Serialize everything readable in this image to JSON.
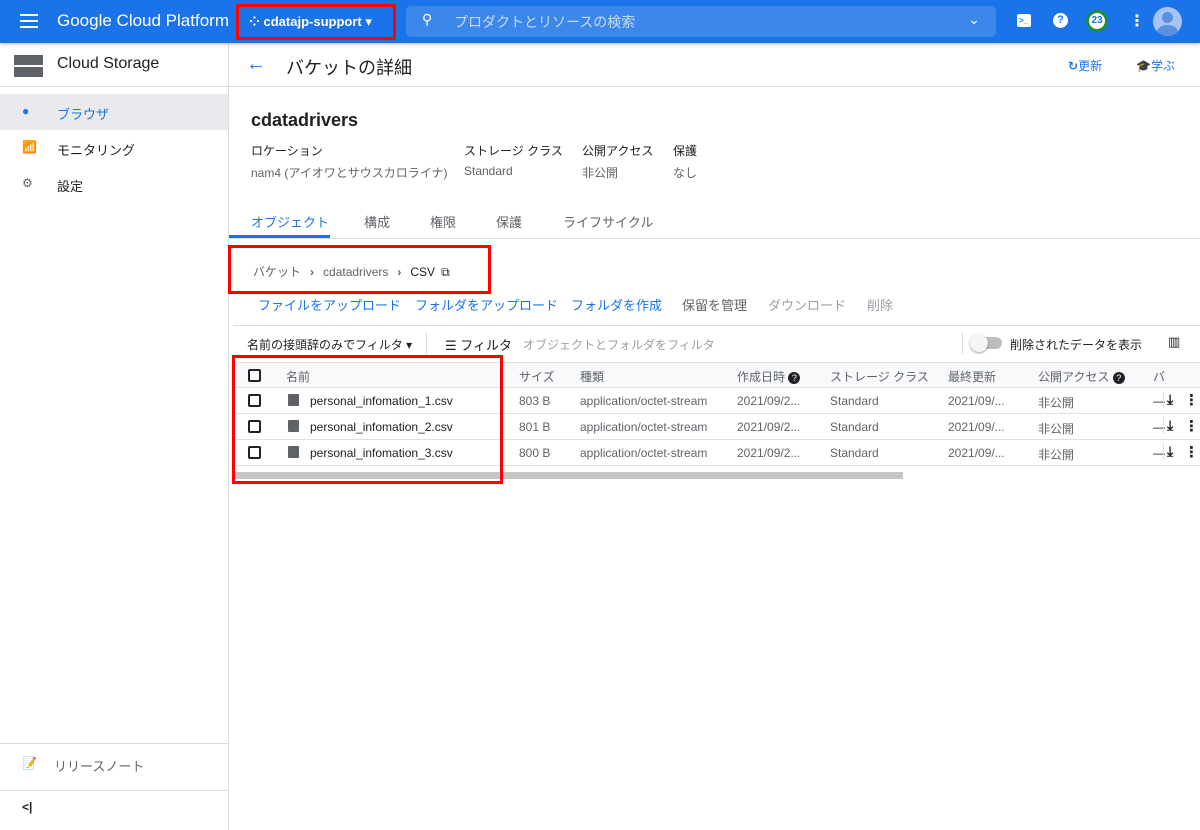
{
  "topbar": {
    "brand": "Google Cloud Platform",
    "project": "cdatajp-support",
    "search_placeholder": "プロダクトとリソースの検索",
    "notifications": "23"
  },
  "sidebar": {
    "title": "Cloud Storage",
    "items": [
      {
        "label": "ブラウザ"
      },
      {
        "label": "モニタリング"
      },
      {
        "label": "設定"
      }
    ],
    "release_notes": "リリースノート",
    "collapse": "<|"
  },
  "header": {
    "title": "バケットの詳細",
    "refresh": "更新",
    "learn": "学ぶ"
  },
  "bucket": {
    "name": "cdatadrivers",
    "props": [
      {
        "label": "ロケーション",
        "value": "nam4 (アイオワとサウスカロライナ)"
      },
      {
        "label": "ストレージ クラス",
        "value": "Standard"
      },
      {
        "label": "公開アクセス",
        "value": "非公開"
      },
      {
        "label": "保護",
        "value": "なし"
      }
    ]
  },
  "tabs": [
    "オブジェクト",
    "構成",
    "権限",
    "保護",
    "ライフサイクル"
  ],
  "breadcrumb": [
    "バケット",
    "cdatadrivers",
    "CSV"
  ],
  "actions": [
    "ファイルをアップロード",
    "フォルダをアップロード",
    "フォルダを作成",
    "保留を管理",
    "ダウンロード",
    "削除"
  ],
  "filter": {
    "prefix": "名前の接頭辞のみでフィルタ",
    "filter_label": "フィルタ",
    "placeholder": "オブジェクトとフォルダをフィルタ",
    "show_deleted": "削除されたデータを表示"
  },
  "table": {
    "columns": [
      "名前",
      "サイズ",
      "種類",
      "作成日時",
      "ストレージ クラス",
      "最終更新",
      "公開アクセス",
      "バ"
    ],
    "rows": [
      {
        "name": "personal_infomation_1.csv",
        "size": "803 B",
        "type": "application/octet-stream",
        "created": "2021/09/2...",
        "class": "Standard",
        "updated": "2021/09/...",
        "access": "非公開",
        "extra": "—"
      },
      {
        "name": "personal_infomation_2.csv",
        "size": "801 B",
        "type": "application/octet-stream",
        "created": "2021/09/2...",
        "class": "Standard",
        "updated": "2021/09/...",
        "access": "非公開",
        "extra": "—"
      },
      {
        "name": "personal_infomation_3.csv",
        "size": "800 B",
        "type": "application/octet-stream",
        "created": "2021/09/2...",
        "class": "Standard",
        "updated": "2021/09/...",
        "access": "非公開",
        "extra": "—"
      }
    ]
  }
}
